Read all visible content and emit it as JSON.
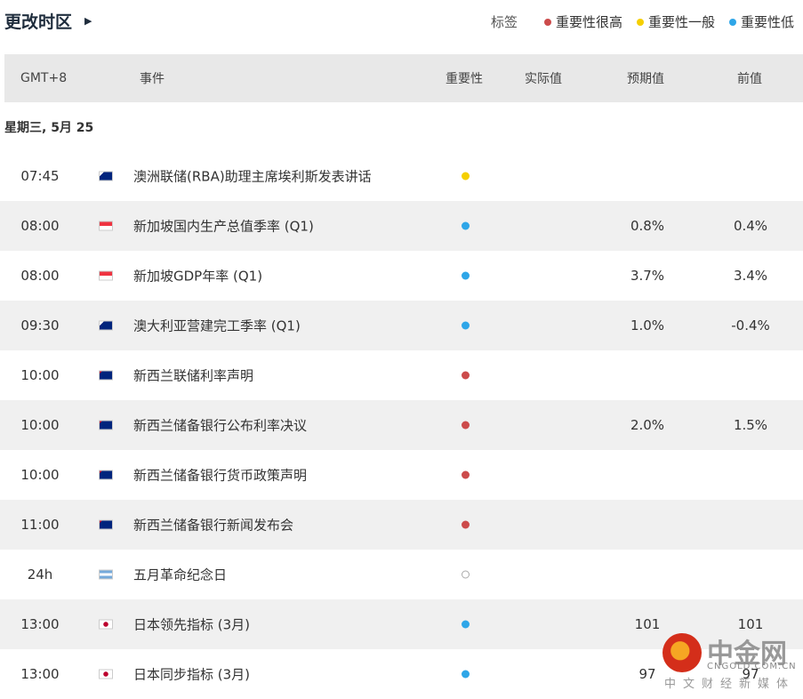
{
  "header": {
    "timezone_label": "更改时区",
    "arrow_icon": "play-triangle"
  },
  "legend": {
    "label": "标签",
    "items": [
      {
        "label": "重要性很高",
        "color": "#cc4b4b"
      },
      {
        "label": "重要性一般",
        "color": "#f5cf00"
      },
      {
        "label": "重要性低",
        "color": "#2ea6e8"
      }
    ]
  },
  "table": {
    "columns": {
      "time": "GMT+8",
      "event": "事件",
      "importance": "重要性",
      "actual": "实际值",
      "forecast": "预期值",
      "previous": "前值"
    }
  },
  "date_heading": "星期三, 5月 25",
  "rows": [
    {
      "time": "07:45",
      "flag": "au",
      "event": "澳洲联储(RBA)助理主席埃利斯发表讲话",
      "importance": "medium",
      "actual": "",
      "forecast": "",
      "previous": ""
    },
    {
      "time": "08:00",
      "flag": "sg",
      "event": "新加坡国内生产总值季率 (Q1)",
      "importance": "low",
      "actual": "",
      "forecast": "0.8%",
      "previous": "0.4%"
    },
    {
      "time": "08:00",
      "flag": "sg",
      "event": "新加坡GDP年率 (Q1)",
      "importance": "low",
      "actual": "",
      "forecast": "3.7%",
      "previous": "3.4%"
    },
    {
      "time": "09:30",
      "flag": "au",
      "event": "澳大利亚营建完工季率 (Q1)",
      "importance": "low",
      "actual": "",
      "forecast": "1.0%",
      "previous": "-0.4%"
    },
    {
      "time": "10:00",
      "flag": "nz",
      "event": "新西兰联储利率声明",
      "importance": "high",
      "actual": "",
      "forecast": "",
      "previous": ""
    },
    {
      "time": "10:00",
      "flag": "nz",
      "event": "新西兰储备银行公布利率决议",
      "importance": "high",
      "actual": "",
      "forecast": "2.0%",
      "previous": "1.5%"
    },
    {
      "time": "10:00",
      "flag": "nz",
      "event": "新西兰储备银行货币政策声明",
      "importance": "high",
      "actual": "",
      "forecast": "",
      "previous": ""
    },
    {
      "time": "11:00",
      "flag": "nz",
      "event": "新西兰储备银行新闻发布会",
      "importance": "high",
      "actual": "",
      "forecast": "",
      "previous": ""
    },
    {
      "time": "24h",
      "flag": "ar",
      "event": "五月革命纪念日",
      "importance": "holiday",
      "actual": "",
      "forecast": "",
      "previous": ""
    },
    {
      "time": "13:00",
      "flag": "jp",
      "event": "日本领先指标 (3月)",
      "importance": "low",
      "actual": "",
      "forecast": "101",
      "previous": "101"
    },
    {
      "time": "13:00",
      "flag": "jp",
      "event": "日本同步指标 (3月)",
      "importance": "low",
      "actual": "",
      "forecast": "97",
      "previous": "97"
    }
  ],
  "watermark": {
    "name": "中金网",
    "domain": "CNGOLD.COM.CN",
    "tagline": "中文财经新媒体"
  }
}
